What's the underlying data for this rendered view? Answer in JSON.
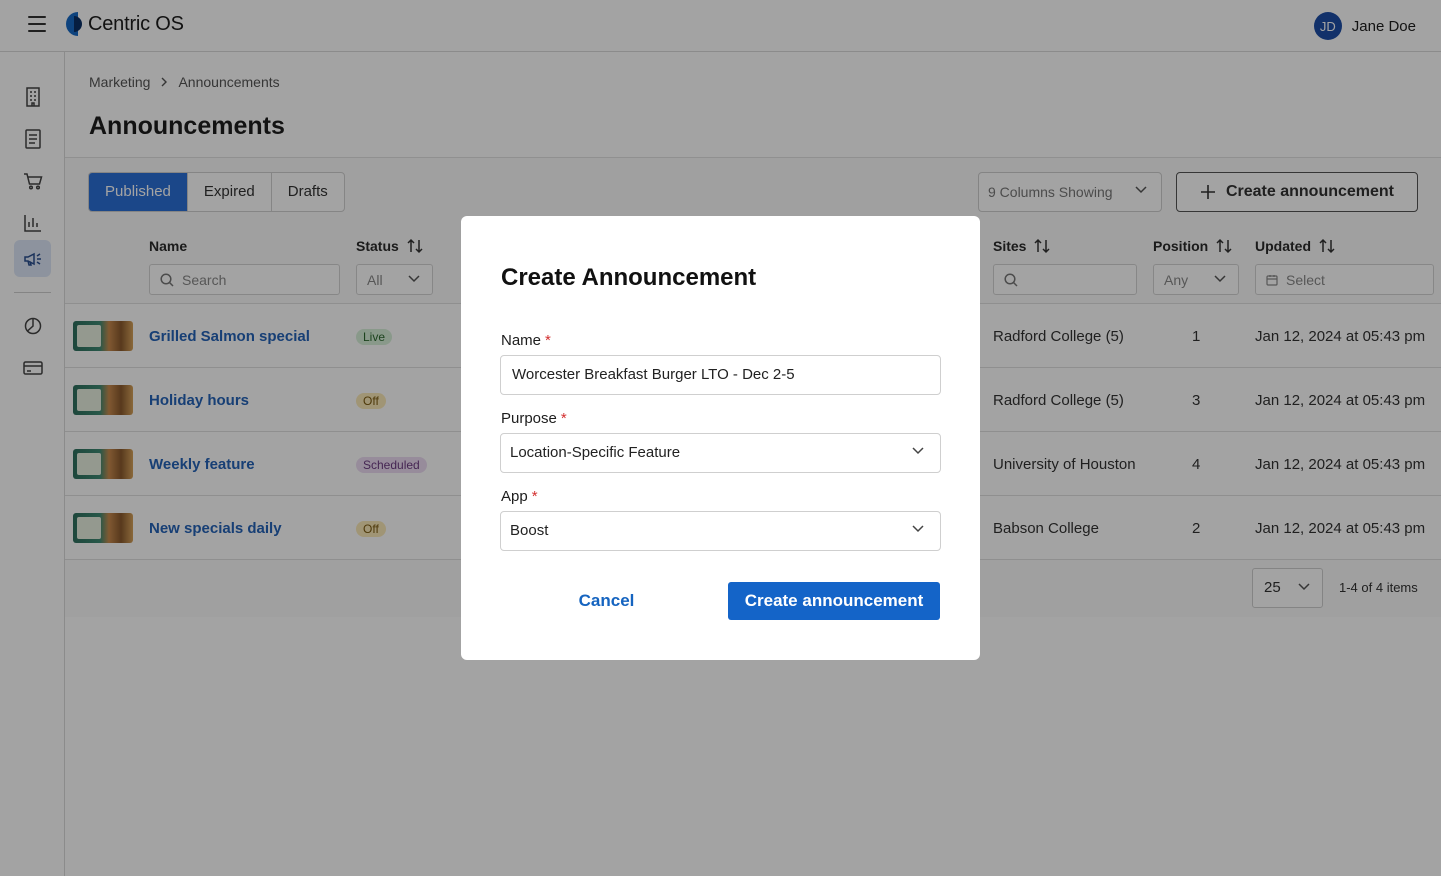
{
  "app": {
    "title": "Centric OS"
  },
  "user": {
    "initials": "JD",
    "name": "Jane Doe"
  },
  "rail": {
    "icons": [
      "building-icon",
      "document-icon",
      "cart-icon",
      "bar-chart-icon",
      "megaphone-icon",
      "pie-chart-icon",
      "card-icon"
    ],
    "active": "megaphone-icon"
  },
  "breadcrumb": {
    "parent": "Marketing",
    "current": "Announcements"
  },
  "page": {
    "title": "Announcements"
  },
  "tabs": [
    {
      "label": "Published",
      "active": true
    },
    {
      "label": "Expired",
      "active": false
    },
    {
      "label": "Drafts",
      "active": false
    }
  ],
  "toolbar": {
    "columns_label": "9 Columns Showing",
    "create_label": "Create announcement"
  },
  "table": {
    "headers": {
      "name": "Name",
      "status": "Status",
      "sites": "Sites",
      "position": "Position",
      "updated": "Updated"
    },
    "filters": {
      "name_placeholder": "Search",
      "status_value": "All",
      "sites_placeholder": "",
      "position_value": "Any",
      "updated_placeholder": "Select"
    },
    "rows": [
      {
        "name": "Grilled Salmon special",
        "status": "Live",
        "status_kind": "live",
        "sites": "Radford College (5)",
        "position": "1",
        "updated": "Jan 12, 2024 at 05:43 pm"
      },
      {
        "name": "Holiday hours",
        "status": "Off",
        "status_kind": "off",
        "sites": "Radford College (5)",
        "position": "3",
        "updated": "Jan 12, 2024 at 05:43 pm"
      },
      {
        "name": "Weekly feature",
        "status": "Scheduled",
        "status_kind": "scheduled",
        "sites": "University of Houston",
        "position": "4",
        "updated": "Jan 12, 2024 at 05:43 pm"
      },
      {
        "name": "New specials daily",
        "status": "Off",
        "status_kind": "off",
        "sites": "Babson College",
        "position": "2",
        "updated": "Jan 12, 2024 at 05:43 pm"
      }
    ]
  },
  "pagination": {
    "page_size": "25",
    "summary": "1-4 of 4 items"
  },
  "modal": {
    "title": "Create Announcement",
    "name_label": "Name",
    "name_value": "Worcester Breakfast Burger LTO - Dec 2-5",
    "purpose_label": "Purpose",
    "purpose_value": "Location-Specific Feature",
    "app_label": "App",
    "app_value": "Boost",
    "required_mark": "*",
    "cancel_label": "Cancel",
    "submit_label": "Create announcement"
  },
  "colors": {
    "primary": "#1464c8",
    "tab_active": "#2b6fd6",
    "link": "#2563b8",
    "required": "#d32f2f"
  }
}
